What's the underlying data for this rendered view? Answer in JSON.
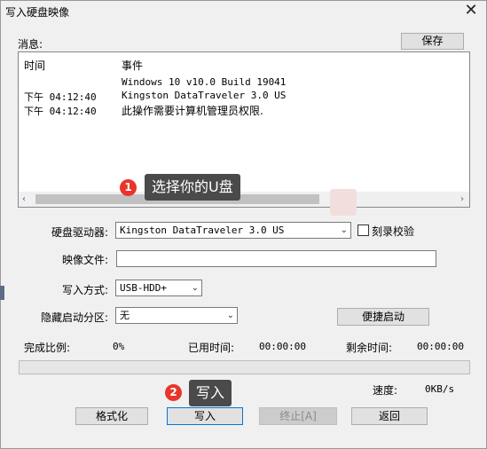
{
  "window": {
    "title": "写入硬盘映像",
    "close_glyph": "✕"
  },
  "messages": {
    "label": "消息:",
    "save_label": "保存",
    "col_time": "时间",
    "col_event": "事件",
    "rows": [
      {
        "time": "",
        "event": "Windows 10 v10.0 Build 19041"
      },
      {
        "time": "下午 04:12:40",
        "event": "Kingston DataTraveler 3.0 US"
      },
      {
        "time": "下午 04:12:40",
        "event": "此操作需要计算机管理员权限."
      }
    ]
  },
  "callouts": [
    {
      "number": "1",
      "text": "选择你的U盘"
    },
    {
      "number": "2",
      "text": "写入"
    }
  ],
  "form": {
    "drive_label": "硬盘驱动器:",
    "drive_value": "Kingston DataTraveler 3.0 US",
    "verify_label": "刻录校验",
    "image_label": "映像文件:",
    "image_value": "",
    "method_label": "写入方式:",
    "method_value": "USB-HDD+",
    "hidden_label": "隐藏启动分区:",
    "hidden_value": "无",
    "quick_boot_label": "便捷启动"
  },
  "status": {
    "complete_label": "完成比例:",
    "complete_value": "0%",
    "elapsed_label": "已用时间:",
    "elapsed_value": "00:00:00",
    "remaining_label": "剩余时间:",
    "remaining_value": "00:00:00",
    "progress": 0,
    "speed_label": "速度:",
    "speed_value": "0KB/s"
  },
  "buttons": {
    "format": "格式化",
    "write": "写入",
    "stop": "终止[A]",
    "back": "返回"
  },
  "colors": {
    "badge": "#e8352c",
    "callout_bg": "#4a4a4a",
    "accent": "#0078d7"
  },
  "icons": {
    "scroll_left": "‹",
    "scroll_right": "›",
    "dropdown": "⌄"
  }
}
